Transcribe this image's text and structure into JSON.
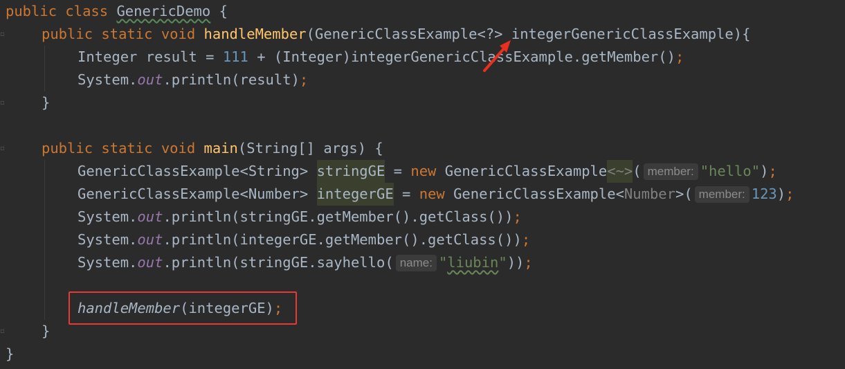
{
  "code": {
    "l1": {
      "kw1": "public",
      "kw2": "class",
      "name": "GenericDemo",
      "brace": "{"
    },
    "l2": {
      "kw1": "public",
      "kw2": "static",
      "kw3": "void",
      "fn": "handleMember",
      "sig": "(GenericClassExample<?> integerGenericClassExample){"
    },
    "l3": {
      "t1": "Integer result = ",
      "num": "111",
      "t2": " + (Integer)integerGenericClassExample.getMember()",
      "semi": ";"
    },
    "l4": {
      "t1": "System.",
      "fld": "out",
      "t2": ".println(result)",
      "semi": ";"
    },
    "l5": {
      "t1": "}"
    },
    "l7": {
      "kw1": "public",
      "kw2": "static",
      "kw3": "void",
      "fn": "main",
      "sig": "(String[] args) {"
    },
    "l8": {
      "t1": "GenericClassExample<String> ",
      "var": "stringGE",
      "t2": " = ",
      "kw": "new",
      "t3": " GenericClassExample",
      "gen": "<~>",
      "t4": "(",
      "hint": "member:",
      "str": "\"hello\"",
      "t5": ")",
      "semi": ";"
    },
    "l9": {
      "t1": "GenericClassExample<Number> ",
      "var": "integerGE",
      "t2": " = ",
      "kw": "new",
      "t3": " GenericClassExample<",
      "gen": "Number",
      "t4": ">(",
      "hint": "member:",
      "num": "123",
      "t5": ")",
      "semi": ";"
    },
    "l10": {
      "t1": "System.",
      "fld": "out",
      "t2": ".println(stringGE.getMember().getClass())",
      "semi": ";"
    },
    "l11": {
      "t1": "System.",
      "fld": "out",
      "t2": ".println(integerGE.getMember().getClass())",
      "semi": ";"
    },
    "l12": {
      "t1": "System.",
      "fld": "out",
      "t2": ".println(stringGE.sayhello(",
      "hint": "name:",
      "str_q1": "\"",
      "str_body": "liubin",
      "str_q2": "\"",
      "t3": "))",
      "semi": ";"
    },
    "l14": {
      "fn": "handleMember",
      "t1": "(integerGE)",
      "semi": ";"
    },
    "l15": {
      "t1": "}"
    },
    "l16": {
      "t1": "}"
    }
  },
  "colors": {
    "background": "#2b2b2b",
    "keyword": "#cc7832",
    "method": "#ffc66d",
    "number": "#6897bb",
    "string": "#6a8759",
    "field": "#9876aa",
    "highlight_box": "#e63a3a",
    "arrow": "#e8301e"
  }
}
